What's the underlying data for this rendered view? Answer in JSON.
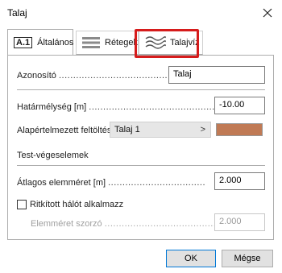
{
  "window": {
    "title": "Talaj"
  },
  "tabs": [
    {
      "badge": "A.1",
      "label": "Általános",
      "icon": "general-icon"
    },
    {
      "label": "Rétegek",
      "icon": "layers-icon"
    },
    {
      "label": "Talajvíz",
      "icon": "groundwater-icon"
    }
  ],
  "fields": {
    "id_label": "Azonosító",
    "id_value": "Talaj",
    "depth_label": "Határmélység [m]",
    "depth_value": "-10.00",
    "fill_label": "Alapértelmezett feltöltés",
    "fill_value": "Talaj 1",
    "fill_arrow": ">",
    "fill_color": "#c07a55"
  },
  "fe_section": {
    "title": "Test-végeselemek",
    "avg_label": "Átlagos elemméret [m]",
    "avg_value": "2.000",
    "thin_label": "Ritkított hálót alkalmazz",
    "factor_label": "Elemméret szorzó",
    "factor_value": "2.000"
  },
  "buttons": {
    "ok": "OK",
    "cancel": "Mégse"
  },
  "colors": {
    "highlight": "#d61c1c",
    "accent": "#0078d7"
  }
}
